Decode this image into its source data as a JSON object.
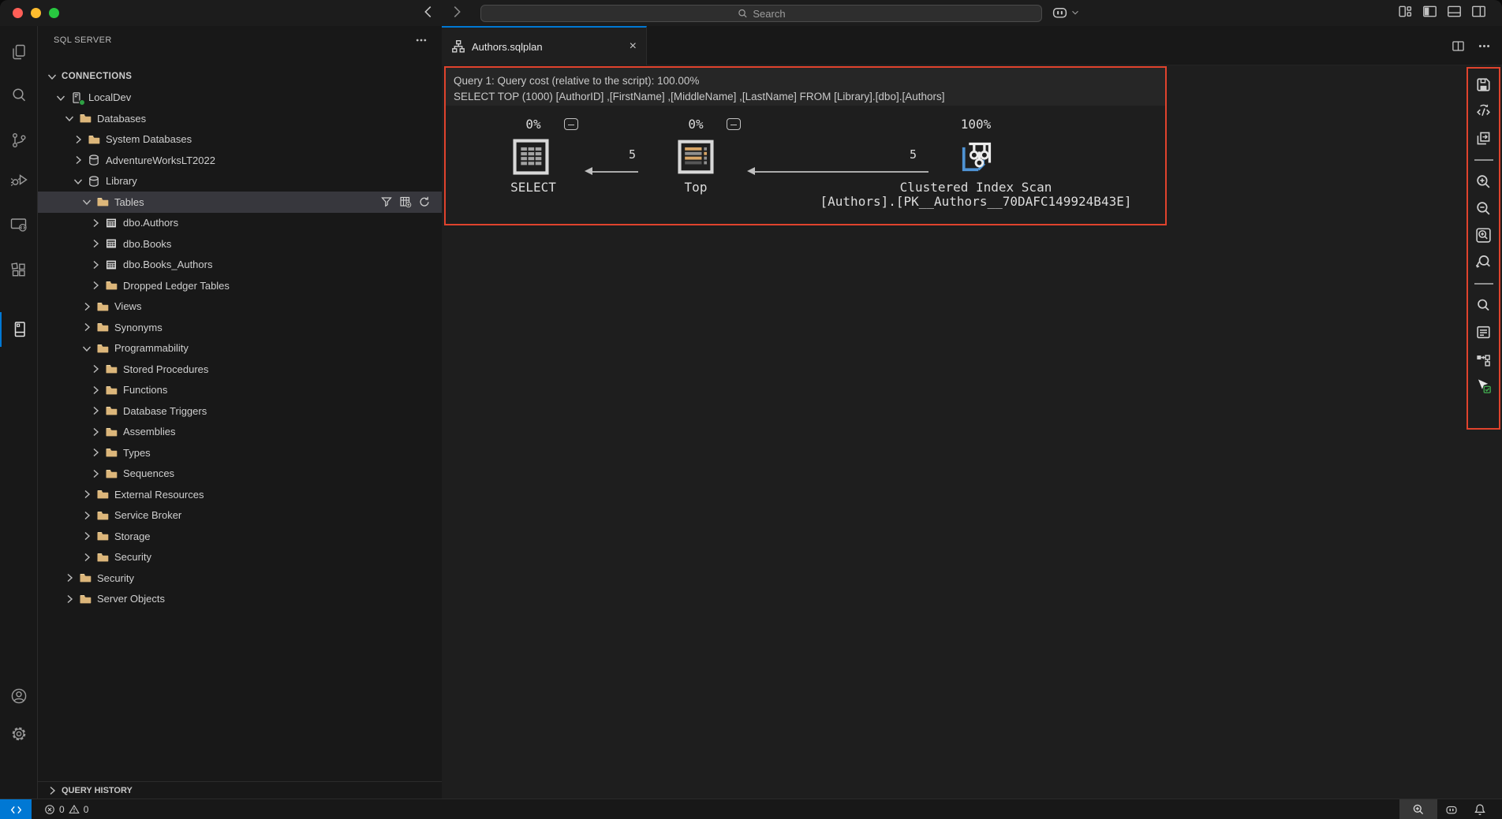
{
  "titlebar": {
    "search_placeholder": "Search",
    "traffic_lights": [
      "#ff5f57",
      "#febc2e",
      "#28c840"
    ],
    "right_icons": [
      "customize-layout",
      "toggle-primary-sidebar",
      "toggle-panel",
      "toggle-secondary-sidebar"
    ],
    "left_icons": [
      "back",
      "forward"
    ],
    "copilot_icon": "copilot"
  },
  "activity_bar": {
    "items": [
      {
        "name": "explorer",
        "active": false
      },
      {
        "name": "search",
        "active": false
      },
      {
        "name": "source-control",
        "active": false
      },
      {
        "name": "run-and-debug",
        "active": false
      },
      {
        "name": "remote-explorer",
        "active": false
      },
      {
        "name": "extensions",
        "active": false
      },
      {
        "name": "sql-server",
        "active": true
      }
    ],
    "bottom": [
      {
        "name": "accounts"
      },
      {
        "name": "settings"
      }
    ]
  },
  "sidebar": {
    "title": "SQL SERVER",
    "tree": [
      {
        "label": "CONNECTIONS",
        "level": 0,
        "state": "expanded",
        "icon": "none"
      },
      {
        "label": "LocalDev",
        "level": 1,
        "state": "expanded",
        "icon": "server-connected"
      },
      {
        "label": "Databases",
        "level": 2,
        "state": "expanded",
        "icon": "folder"
      },
      {
        "label": "System Databases",
        "level": 3,
        "state": "collapsed",
        "icon": "folder"
      },
      {
        "label": "AdventureWorksLT2022",
        "level": 3,
        "state": "collapsed",
        "icon": "database"
      },
      {
        "label": "Library",
        "level": 3,
        "state": "expanded",
        "icon": "database"
      },
      {
        "label": "Tables",
        "level": 4,
        "state": "expanded",
        "icon": "folder",
        "selected": true,
        "actions": [
          "filter",
          "add-table",
          "refresh"
        ]
      },
      {
        "label": "dbo.Authors",
        "level": 5,
        "state": "collapsed",
        "icon": "table"
      },
      {
        "label": "dbo.Books",
        "level": 5,
        "state": "collapsed",
        "icon": "table"
      },
      {
        "label": "dbo.Books_Authors",
        "level": 5,
        "state": "collapsed",
        "icon": "table"
      },
      {
        "label": "Dropped Ledger Tables",
        "level": 5,
        "state": "collapsed",
        "icon": "folder"
      },
      {
        "label": "Views",
        "level": 4,
        "state": "collapsed",
        "icon": "folder"
      },
      {
        "label": "Synonyms",
        "level": 4,
        "state": "collapsed",
        "icon": "folder"
      },
      {
        "label": "Programmability",
        "level": 4,
        "state": "expanded",
        "icon": "folder"
      },
      {
        "label": "Stored Procedures",
        "level": 5,
        "state": "collapsed",
        "icon": "folder"
      },
      {
        "label": "Functions",
        "level": 5,
        "state": "collapsed",
        "icon": "folder"
      },
      {
        "label": "Database Triggers",
        "level": 5,
        "state": "collapsed",
        "icon": "folder"
      },
      {
        "label": "Assemblies",
        "level": 5,
        "state": "collapsed",
        "icon": "folder"
      },
      {
        "label": "Types",
        "level": 5,
        "state": "collapsed",
        "icon": "folder"
      },
      {
        "label": "Sequences",
        "level": 5,
        "state": "collapsed",
        "icon": "folder"
      },
      {
        "label": "External Resources",
        "level": 4,
        "state": "collapsed",
        "icon": "folder"
      },
      {
        "label": "Service Broker",
        "level": 4,
        "state": "collapsed",
        "icon": "folder"
      },
      {
        "label": "Storage",
        "level": 4,
        "state": "collapsed",
        "icon": "folder"
      },
      {
        "label": "Security",
        "level": 4,
        "state": "collapsed",
        "icon": "folder"
      },
      {
        "label": "Security",
        "level": 2,
        "state": "collapsed",
        "icon": "folder"
      },
      {
        "label": "Server Objects",
        "level": 2,
        "state": "collapsed",
        "icon": "folder"
      }
    ],
    "bottom_section": {
      "label": "QUERY HISTORY",
      "state": "collapsed"
    }
  },
  "editor": {
    "tabs": [
      {
        "label": "Authors.sqlplan",
        "active": true,
        "icon": "execution-plan"
      }
    ],
    "plan": {
      "query_title": "Query 1: Query cost (relative to the script): 100.00%",
      "query_text": "SELECT TOP (1000) [AuthorID] ,[FirstName] ,[MiddleName] ,[LastName] FROM [Library].[dbo].[Authors]",
      "nodes": [
        {
          "label": "SELECT",
          "cost": "0%",
          "icon": "result-icon"
        },
        {
          "label": "Top",
          "cost": "0%",
          "icon": "top-icon"
        },
        {
          "label": "Clustered Index Scan",
          "cost": "100%",
          "subtitle": "[Authors].[PK__Authors__70DAFC149924B43E]",
          "icon": "clustered-index-scan-icon"
        }
      ],
      "edges": [
        {
          "rows": "5"
        },
        {
          "rows": "5"
        }
      ],
      "highlight_color": "#e0432d"
    },
    "plan_toolbar": {
      "items": [
        "save-plan",
        "show-query-xml",
        "open-query",
        "zoom-in",
        "zoom-out",
        "zoom-to-fit",
        "custom-zoom",
        "find-node",
        "properties",
        "highlight-expensive-operation",
        "toggle-tooltips"
      ]
    }
  },
  "status_bar": {
    "remote_icon": "remote-indicator",
    "errors": "0",
    "warnings": "0",
    "right_icons": [
      "zoom",
      "copilot",
      "notifications"
    ],
    "remote_bg": "#0078d4"
  },
  "colors": {
    "accent": "#0078d4",
    "folder": "#dcb67a",
    "highlight": "#e0432d",
    "selection": "#37373d"
  }
}
